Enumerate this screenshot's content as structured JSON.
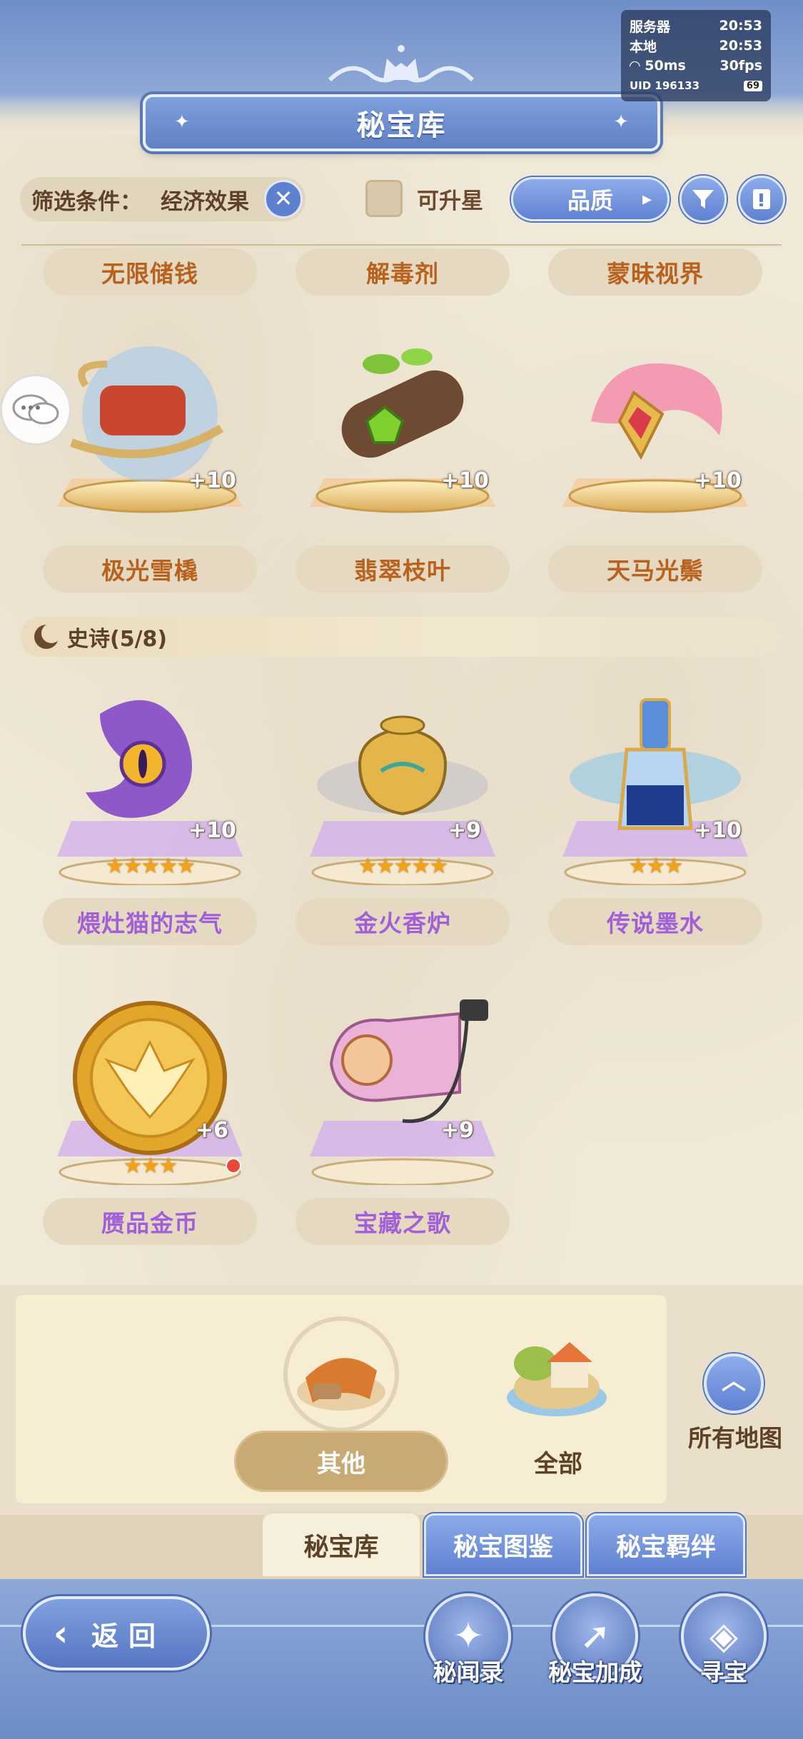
{
  "status": {
    "server_label": "服务器",
    "server_time": "20:53",
    "local_label": "本地",
    "local_time": "20:53",
    "ping": "50ms",
    "fps": "30fps",
    "uid": "UID 196133",
    "battery": "69"
  },
  "header": {
    "title": "秘宝库"
  },
  "filter": {
    "label": "筛选条件：",
    "value": "经济效果",
    "clear_icon": "✕",
    "upgrade_label": "可升星",
    "sort_label": "品质"
  },
  "legend_row_top": {
    "names": [
      "无限储钱",
      "解毒剂",
      "蒙昧视界"
    ]
  },
  "legend_items": [
    {
      "name": "极光雪橇",
      "plus": "+10",
      "icon": "sled-icon"
    },
    {
      "name": "翡翠枝叶",
      "plus": "+10",
      "icon": "log-icon"
    },
    {
      "name": "天马光鬃",
      "plus": "+10",
      "icon": "mane-icon"
    }
  ],
  "epic_section": {
    "title": "史诗(5/8)"
  },
  "epic_items": [
    {
      "name": "煨灶猫的志气",
      "plus": "+10",
      "stars": "★★★★★",
      "icon": "eye-cloak-icon"
    },
    {
      "name": "金火香炉",
      "plus": "+9",
      "stars": "★★★★★",
      "icon": "censer-icon"
    },
    {
      "name": "传说墨水",
      "plus": "+10",
      "stars": "★★★",
      "icon": "ink-bottle-icon"
    },
    {
      "name": "赝品金币",
      "plus": "+6",
      "stars": "★★★",
      "icon": "gold-coin-icon"
    },
    {
      "name": "宝藏之歌",
      "plus": "+9",
      "stars": "",
      "icon": "conch-horn-icon"
    }
  ],
  "map_selector": {
    "active": "其他",
    "other": "全部",
    "all_maps": "所有地图"
  },
  "bottom_tabs": [
    "秘宝库",
    "秘宝图鉴",
    "秘宝羁绊"
  ],
  "footer": {
    "back": "返回",
    "buttons": [
      "秘闻录",
      "秘宝加成",
      "寻宝"
    ]
  },
  "colors": {
    "accent_blue": "#5f81d0",
    "legend_text": "#b8621e",
    "epic_text": "#a160d8",
    "parchment": "#efe6d2"
  }
}
